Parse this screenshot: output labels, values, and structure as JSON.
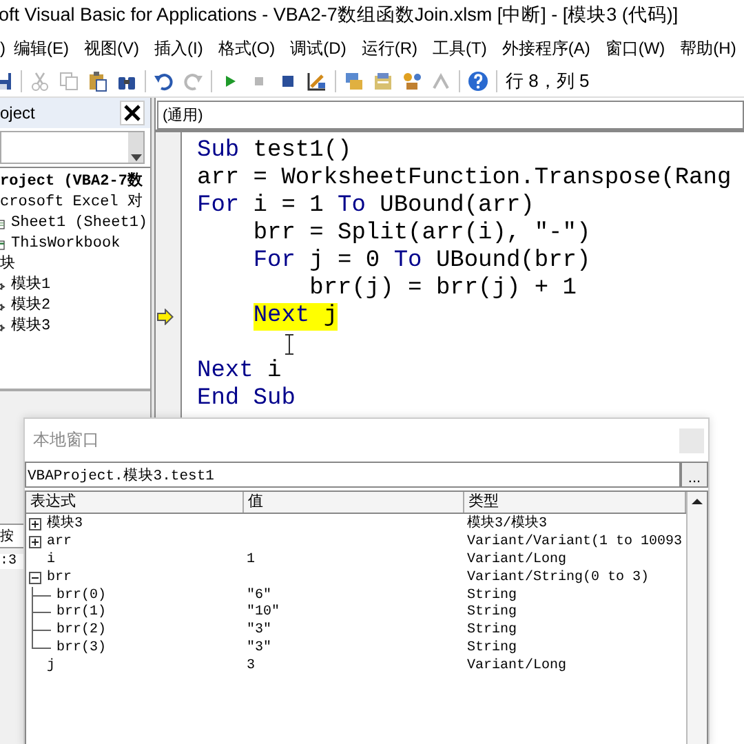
{
  "window": {
    "title": "oft Visual Basic for Applications - VBA2-7数组函数Join.xlsm [中断] - [模块3 (代码)]"
  },
  "menu": [
    ")",
    "编辑(E)",
    "视图(V)",
    "插入(I)",
    "格式(O)",
    "调试(D)",
    "运行(R)",
    "工具(T)",
    "外接程序(A)",
    "窗口(W)",
    "帮助(H)"
  ],
  "toolbar": [
    {
      "kind": "save",
      "disabled": false
    },
    {
      "kind": "separator"
    },
    {
      "kind": "cut",
      "disabled": true
    },
    {
      "kind": "copy",
      "disabled": true
    },
    {
      "kind": "paste",
      "disabled": false
    },
    {
      "kind": "find",
      "disabled": false
    },
    {
      "kind": "separator"
    },
    {
      "kind": "undo",
      "disabled": false
    },
    {
      "kind": "redo",
      "disabled": true
    },
    {
      "kind": "separator"
    },
    {
      "kind": "run",
      "disabled": false
    },
    {
      "kind": "break",
      "disabled": true
    },
    {
      "kind": "reset",
      "disabled": false
    },
    {
      "kind": "design",
      "disabled": false
    },
    {
      "kind": "separator"
    },
    {
      "kind": "explorer",
      "disabled": false
    },
    {
      "kind": "properties",
      "disabled": false
    },
    {
      "kind": "browser",
      "disabled": false
    },
    {
      "kind": "toolbox",
      "disabled": true
    },
    {
      "kind": "separator"
    },
    {
      "kind": "help",
      "disabled": false
    },
    {
      "kind": "separator"
    }
  ],
  "cursor_position": "行 8，列 5",
  "project_explorer": {
    "title": "oject",
    "tree": [
      {
        "label": "roject (VBA2-7数",
        "kind": "project",
        "children": [
          {
            "label": "crosoft Excel 对",
            "children": [
              {
                "label": "Sheet1 (Sheet1)",
                "kind": "sheet"
              },
              {
                "label": "ThisWorkbook",
                "kind": "workbook"
              }
            ]
          },
          {
            "label": "块",
            "children": [
              {
                "label": "模块1",
                "kind": "module"
              },
              {
                "label": "模块2",
                "kind": "module"
              },
              {
                "label": "模块3",
                "kind": "module"
              }
            ]
          }
        ]
      }
    ]
  },
  "properties": {
    "tab": "按",
    "value": ":3"
  },
  "code_window": {
    "object": "(通用)",
    "lines": [
      {
        "kind": "code",
        "parts": [
          {
            "kind": "keyword",
            "text": "Sub"
          },
          {
            "kind": "plain",
            "text": " test1()"
          }
        ],
        "current": false
      },
      {
        "kind": "code",
        "parts": [
          {
            "kind": "plain",
            "text": "arr = WorksheetFunction.Transpose(Rang"
          }
        ],
        "current": false
      },
      {
        "kind": "code",
        "parts": [
          {
            "kind": "keyword",
            "text": "For"
          },
          {
            "kind": "plain",
            "text": " i = 1 "
          },
          {
            "kind": "keyword",
            "text": "To"
          },
          {
            "kind": "plain",
            "text": " UBound(arr)"
          }
        ],
        "current": false
      },
      {
        "kind": "code",
        "parts": [
          {
            "kind": "plain",
            "text": "    brr = Split(arr(i), \"-\")"
          }
        ],
        "current": false
      },
      {
        "kind": "code",
        "parts": [
          {
            "kind": "keyword",
            "text": "    For"
          },
          {
            "kind": "plain",
            "text": " j = 0 "
          },
          {
            "kind": "keyword",
            "text": "To"
          },
          {
            "kind": "plain",
            "text": " UBound(brr)"
          }
        ],
        "current": false
      },
      {
        "kind": "code",
        "parts": [
          {
            "kind": "plain",
            "text": "        brr(j) = brr(j) + 1"
          }
        ],
        "current": false
      },
      {
        "kind": "code",
        "parts": [
          {
            "kind": "keyword",
            "text": "    Next"
          },
          {
            "kind": "plain",
            "text": " j"
          }
        ],
        "current": true
      },
      {
        "kind": "blank"
      },
      {
        "kind": "code",
        "parts": [
          {
            "kind": "keyword",
            "text": "Next"
          },
          {
            "kind": "plain",
            "text": " i"
          }
        ],
        "current": false
      },
      {
        "kind": "code",
        "parts": [
          {
            "kind": "keyword",
            "text": "End Sub"
          }
        ],
        "current": false
      }
    ]
  },
  "locals": {
    "title": "本地窗口",
    "context": "VBAProject.模块3.test1",
    "more_button": "...",
    "columns": [
      "表达式",
      "值",
      "类型"
    ],
    "rows": [
      {
        "expression": "模块3",
        "type": "模块3/模块3",
        "expanded": false
      },
      {
        "expression": "arr",
        "type": "Variant/Variant(1 to 10093",
        "expanded": false
      },
      {
        "expression": "i",
        "value": "1",
        "type": "Variant/Long"
      },
      {
        "expression": "brr",
        "type": "Variant/String(0 to 3)",
        "expanded": true,
        "children": [
          {
            "expression": "brr(0)",
            "value": "\"6\"",
            "type": "String"
          },
          {
            "expression": "brr(1)",
            "value": "\"10\"",
            "type": "String"
          },
          {
            "expression": "brr(2)",
            "value": "\"3\"",
            "type": "String"
          },
          {
            "expression": "brr(3)",
            "value": "\"3\"",
            "type": "String"
          }
        ]
      },
      {
        "expression": "j",
        "value": "3",
        "type": "Variant/Long"
      }
    ]
  }
}
